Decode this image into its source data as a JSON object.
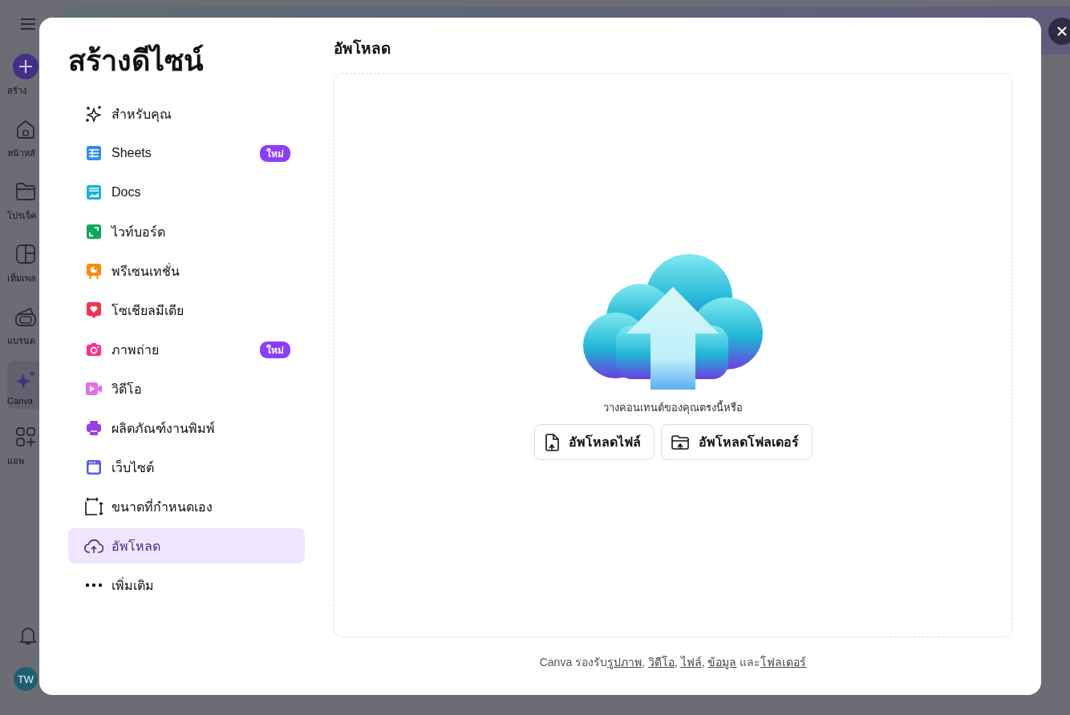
{
  "app_nav": {
    "items": [
      {
        "label": "สร้าง",
        "kind": "create",
        "selected": false
      },
      {
        "label": "หน้าหลั",
        "kind": "home",
        "selected": false
      },
      {
        "label": "โปรเจ็ค",
        "kind": "folder",
        "selected": false
      },
      {
        "label": "เท็มเพล",
        "kind": "template",
        "selected": false
      },
      {
        "label": "แบรนด",
        "kind": "brand",
        "selected": false
      },
      {
        "label": "Canva",
        "kind": "sparkle",
        "selected": true
      },
      {
        "label": "แอพ",
        "kind": "apps",
        "selected": false
      }
    ],
    "avatar": "TW"
  },
  "dialog": {
    "title": "สร้างดีไซน์",
    "menu": [
      {
        "label": "สำหรับคุณ",
        "kind": "sparkle",
        "selected": false
      },
      {
        "label": "Sheets",
        "kind": "sheets",
        "badge": "ใหม่",
        "selected": false
      },
      {
        "label": "Docs",
        "kind": "docs",
        "selected": false
      },
      {
        "label": "ไวท์บอร์ด",
        "kind": "whiteboard",
        "selected": false
      },
      {
        "label": "พรีเซนเทชั่น",
        "kind": "presentation",
        "selected": false
      },
      {
        "label": "โซเชียลมีเดีย",
        "kind": "social",
        "selected": false
      },
      {
        "label": "ภาพถ่าย",
        "kind": "photo",
        "badge": "ใหม่",
        "selected": false
      },
      {
        "label": "วิดีโอ",
        "kind": "video",
        "selected": false
      },
      {
        "label": "ผลิตภัณฑ์งานพิมพ์",
        "kind": "print",
        "selected": false
      },
      {
        "label": "เว็บไซต์",
        "kind": "website",
        "selected": false
      },
      {
        "label": "ขนาดที่กำหนดเอง",
        "kind": "custom",
        "selected": false
      },
      {
        "label": "อัพโหลด",
        "kind": "upload",
        "selected": true
      },
      {
        "label": "เพิ่มเติม",
        "kind": "more",
        "selected": false
      }
    ],
    "panel": {
      "heading": "อัพโหลด",
      "drop_hint": "วางคอนเทนต์ของคุณตรงนี้หรือ",
      "buttons": [
        {
          "label": "อัพโหลดไฟล์",
          "kind": "file"
        },
        {
          "label": "อัพโหลดโฟลเดอร์",
          "kind": "folder"
        }
      ],
      "footer": [
        {
          "text": "Canva รองรับ",
          "link": false
        },
        {
          "text": "รูปภาพ",
          "link": true
        },
        {
          "text": ", ",
          "link": false
        },
        {
          "text": "วิดีโอ",
          "link": true
        },
        {
          "text": ", ",
          "link": false
        },
        {
          "text": "ไฟล์",
          "link": true
        },
        {
          "text": ", ",
          "link": false
        },
        {
          "text": "ข้อมูล",
          "link": true
        },
        {
          "text": " และ",
          "link": false
        },
        {
          "text": "โฟลเดอร์",
          "link": true
        }
      ]
    }
  }
}
